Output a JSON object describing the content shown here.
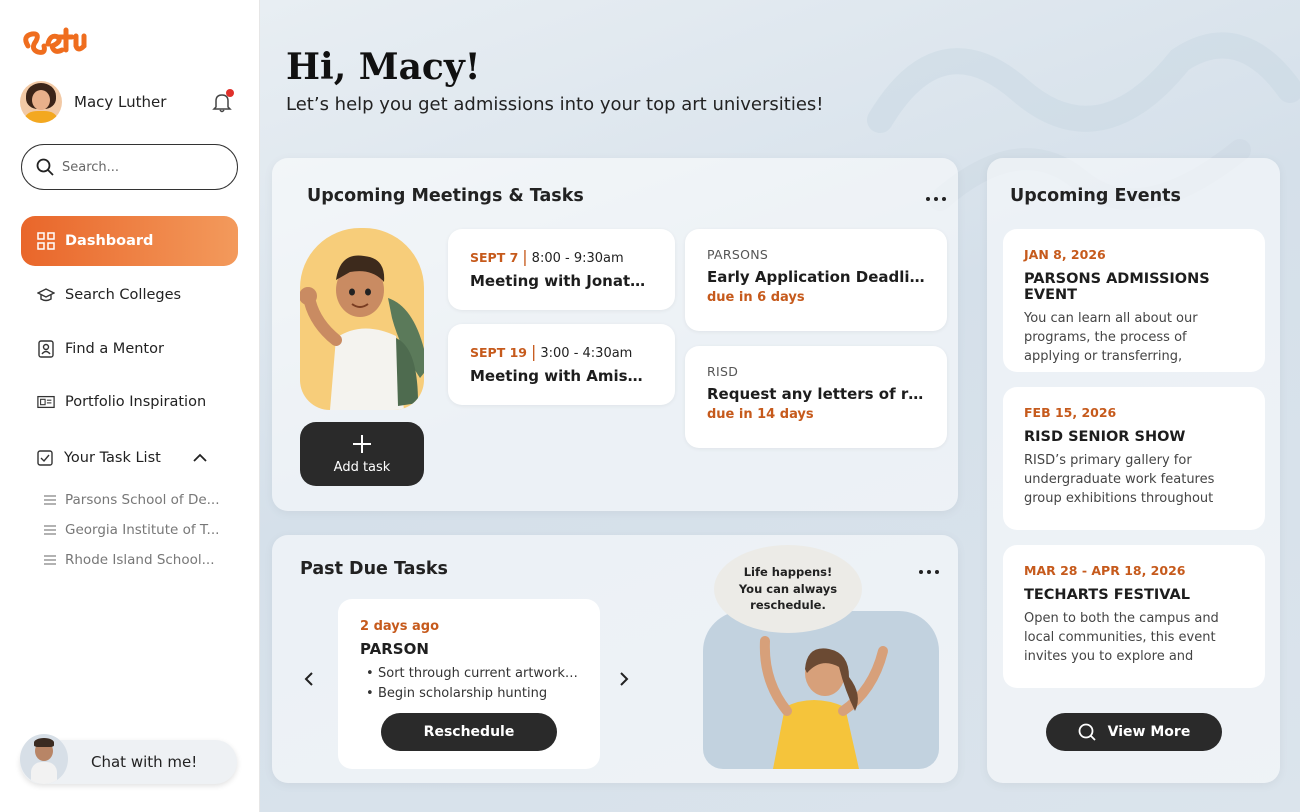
{
  "brand": {
    "logo_text": "setu",
    "accent": "#e9662a"
  },
  "user": {
    "name": "Macy Luther",
    "has_notification": true
  },
  "search": {
    "placeholder": "Search..."
  },
  "nav": [
    {
      "label": "Dashboard",
      "icon": "dashboard-icon",
      "active": true
    },
    {
      "label": "Search Colleges",
      "icon": "graduation-cap-icon",
      "active": false
    },
    {
      "label": "Find a Mentor",
      "icon": "mentor-icon",
      "active": false
    },
    {
      "label": "Portfolio Inspiration",
      "icon": "portfolio-icon",
      "active": false
    }
  ],
  "tasklist": {
    "label": "Your Task List",
    "expanded": true,
    "items": [
      "Parsons School of De...",
      "Georgia Institute of T...",
      "Rhode Island School..."
    ]
  },
  "chat": {
    "label": "Chat with me!"
  },
  "greeting": {
    "title": "Hi, Macy!",
    "subtitle": "Let’s help you get admissions into your top art universities!"
  },
  "meetings": {
    "title": "Upcoming Meetings & Tasks",
    "items": [
      {
        "date": "SEPT 7",
        "time": "8:00 - 9:30am",
        "title": "Meeting with Jonathan..."
      },
      {
        "date": "SEPT 19",
        "time": "3:00 - 4:30am",
        "title": "Meeting with Amisha P..."
      }
    ],
    "tasks": [
      {
        "school": "PARSONS",
        "title": "Early Application Deadline",
        "due": "due in 6 days"
      },
      {
        "school": "RISD",
        "title": "Request any letters of reco...",
        "due": "due in 14 days"
      }
    ],
    "add_task_label": "Add task"
  },
  "past_due": {
    "title": "Past Due Tasks",
    "card": {
      "ago": "2 days ago",
      "school": "PARSON",
      "bullets": [
        "Sort through current artwork f...",
        "Begin scholarship hunting"
      ],
      "button": "Reschedule"
    },
    "bubble_lines": [
      "Life happens!",
      "You can always",
      "reschedule."
    ]
  },
  "events": {
    "title": "Upcoming Events",
    "items": [
      {
        "date": "JAN 8, 2026",
        "title": "PARSONS ADMISSIONS EVENT",
        "desc": "You can learn all about our programs, the process of applying or transferring, preparation of a p..."
      },
      {
        "date": "FEB 15, 2026",
        "title": "RISD SENIOR SHOW",
        "desc": "RISD’s primary gallery for undergraduate work features group exhibitions throughout the..."
      },
      {
        "date": "MAR 28 - APR 18, 2026",
        "title": "TECHARTS FESTIVAL",
        "desc": "Open to both the campus and local communities, this event invites you to explore and experie..."
      }
    ],
    "view_more": "View More"
  }
}
